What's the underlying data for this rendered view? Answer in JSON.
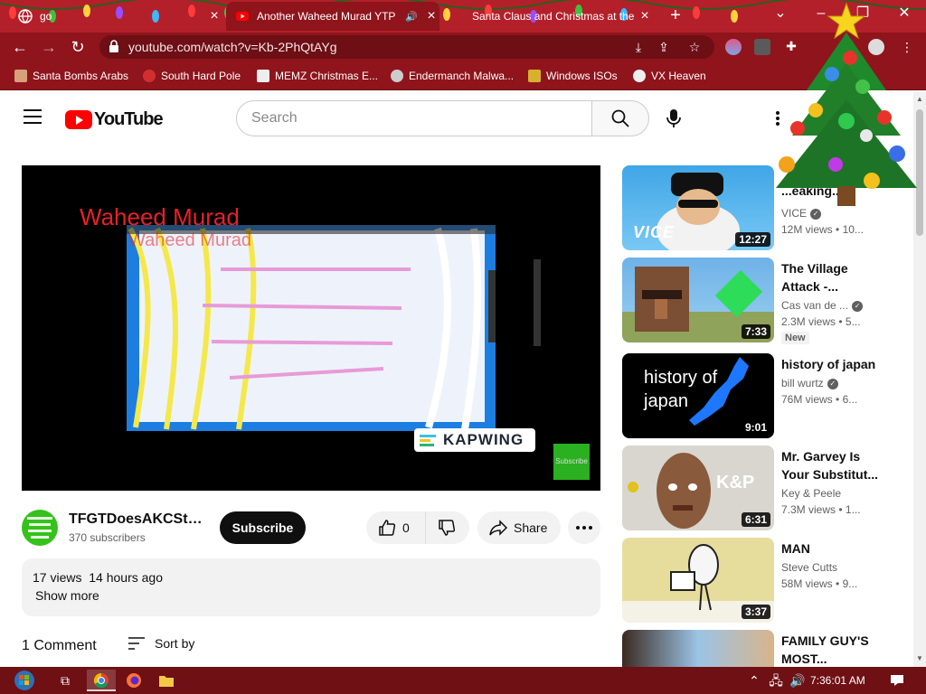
{
  "browser": {
    "tabs": [
      {
        "title": "go",
        "active": false
      },
      {
        "title": "Another Waheed Murad YTP",
        "active": true
      },
      {
        "title": "Santa Claus and Christmas at the",
        "active": false
      }
    ],
    "omnibox": {
      "url": "youtube.com/watch?v=Kb-2PhQtAYg"
    },
    "bookmarks": [
      {
        "label": "Santa Bombs Arabs"
      },
      {
        "label": "South Hard Pole"
      },
      {
        "label": "MEMZ Christmas E..."
      },
      {
        "label": "Endermanch Malwa..."
      },
      {
        "label": "Windows ISOs"
      },
      {
        "label": "VX Heaven"
      }
    ]
  },
  "youtube": {
    "logo_text": "YouTube",
    "search_placeholder": "Search"
  },
  "video": {
    "overlay_title_1": "Waheed Murad",
    "overlay_title_2": "Waheed Murad",
    "kapwing_label": "KAPWING",
    "overlay_subscribe": "Subscribe",
    "channel_name": "TFGTDoesAKCStu...",
    "subscribers": "370 subscribers",
    "subscribe_label": "Subscribe",
    "likes": "0",
    "share_label": "Share",
    "views": "17 views",
    "uploaded": "14 hours ago",
    "show_more": "Show more",
    "comments_count": "1 Comment",
    "sort_label": "Sort by"
  },
  "recommendations": [
    {
      "title": "...eaking...",
      "channel": "VICE",
      "verified": true,
      "views": "12M views",
      "age": "10...",
      "duration": "12:27",
      "thumb_text": "VICE"
    },
    {
      "title": "The Village Attack -...",
      "channel": "Cas van de ...",
      "verified": true,
      "views": "2.3M views",
      "age": "5...",
      "duration": "7:33",
      "badge": "New"
    },
    {
      "title": "history of japan",
      "channel": "bill wurtz",
      "verified": true,
      "views": "76M views",
      "age": "6...",
      "duration": "9:01",
      "thumb_text": "history of japan"
    },
    {
      "title": "Mr. Garvey Is Your Substitut...",
      "channel": "Key & Peele",
      "verified": false,
      "views": "7.3M views",
      "age": "1...",
      "duration": "6:31",
      "thumb_text": "K&P"
    },
    {
      "title": "MAN",
      "channel": "Steve Cutts",
      "verified": false,
      "views": "58M views",
      "age": "9...",
      "duration": "3:37"
    },
    {
      "title": "FAMILY GUY'S MOST..."
    }
  ],
  "taskbar": {
    "clock": "7:36:01 AM"
  },
  "colors": {
    "tab_strip": "#b3202a",
    "chrome_dark": "#8f141c",
    "youtube_red": "#ff0000",
    "subscribe_bg": "#0f0f0f",
    "taskbar": "#6e1014"
  }
}
